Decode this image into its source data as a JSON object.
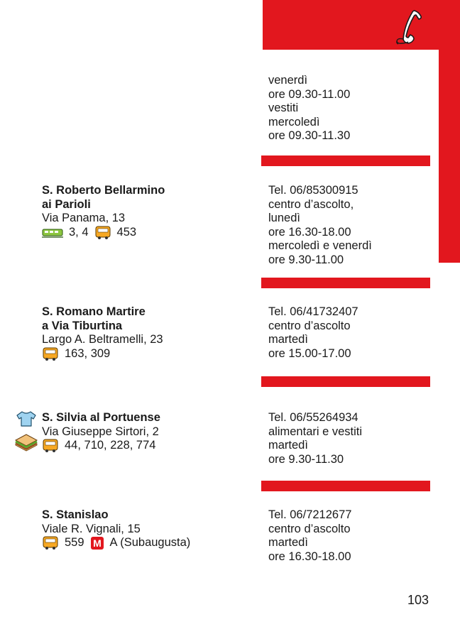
{
  "entries": [
    {
      "right": [
        "venerdì",
        "ore 09.30-11.00",
        "vestiti",
        "mercoledì",
        "ore 09.30-11.30"
      ]
    },
    {
      "name": [
        "S. Roberto Bellarmino",
        "ai Parioli"
      ],
      "address": "Via Panama, 13",
      "transit": {
        "tram_lines": "3, 4",
        "bus_lines": "453"
      },
      "right": [
        "Tel. 06/85300915",
        "centro d’ascolto,",
        "lunedì",
        "ore 16.30-18.00",
        "mercoledì e venerdì",
        "ore 9.30-11.00"
      ]
    },
    {
      "name": [
        "S. Romano Martire",
        "a Via Tiburtina"
      ],
      "address": "Largo A. Beltramelli, 23",
      "transit": {
        "bus_lines": "163, 309"
      },
      "right": [
        "Tel. 06/41732407",
        "centro d’ascolto",
        "martedì",
        "ore 15.00-17.00"
      ]
    },
    {
      "name": [
        "S. Silvia al Portuense"
      ],
      "address": "Via Giuseppe Sirtori, 2",
      "transit": {
        "bus_lines": "44, 710, 228, 774"
      },
      "service_icons": [
        "t-shirt-icon",
        "sandwich-icon"
      ],
      "right": [
        "Tel. 06/55264934",
        "alimentari e vestiti",
        "martedì",
        "ore 9.30-11.30"
      ]
    },
    {
      "name": [
        "S. Stanislao"
      ],
      "address": "Viale R. Vignali, 15",
      "transit": {
        "bus_lines": "559",
        "metro_letter": "M",
        "metro_line": "A (Subaugusta)"
      },
      "right": [
        "Tel. 06/7212677",
        "centro d’ascolto",
        "martedì",
        "ore 16.30-18.00"
      ]
    }
  ],
  "page_number": "103",
  "colors": {
    "accent": "#e2171e",
    "text": "#1a1a1a"
  },
  "icons": {
    "header": "telephone-icon",
    "tram": "tram-icon",
    "bus": "bus-icon",
    "metro": "metro-icon"
  }
}
